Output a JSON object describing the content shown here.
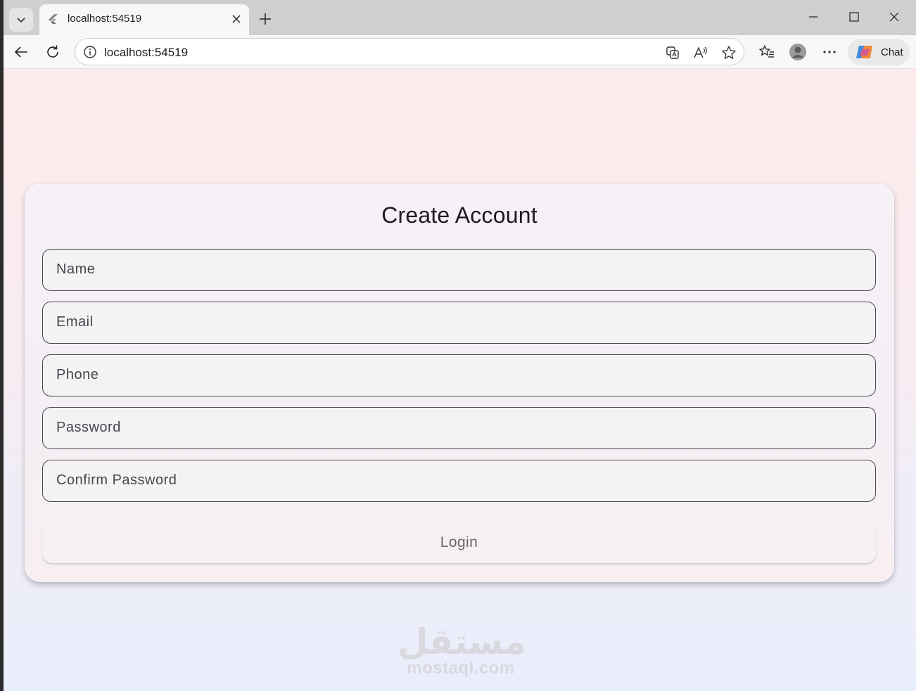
{
  "browser": {
    "tab": {
      "title": "localhost:54519"
    },
    "address": {
      "url": "localhost:54519"
    },
    "chat_label": "Chat",
    "icons": {
      "tab_list": "chevron-down-icon",
      "new_tab": "plus-icon",
      "back": "back-arrow-icon",
      "reload": "reload-icon",
      "site_info": "info-icon",
      "favorite": "star-icon",
      "read_aloud": "read-aloud-icon",
      "translate": "translate-icon"
    }
  },
  "form": {
    "title": "Create Account",
    "fields": [
      {
        "label": "Name"
      },
      {
        "label": "Email"
      },
      {
        "label": "Phone"
      },
      {
        "label": "Password"
      },
      {
        "label": "Confirm Password"
      }
    ],
    "button_label": "Login"
  },
  "watermark": {
    "arabic": "مستقل",
    "latin": "mostaql.com"
  },
  "colors": {
    "page_top": "#fcebea",
    "page_bottom": "#e9eefc",
    "card_bg": "#f6f1f7",
    "field_border": "#4a4650",
    "text_dark": "#1c1b1f"
  }
}
